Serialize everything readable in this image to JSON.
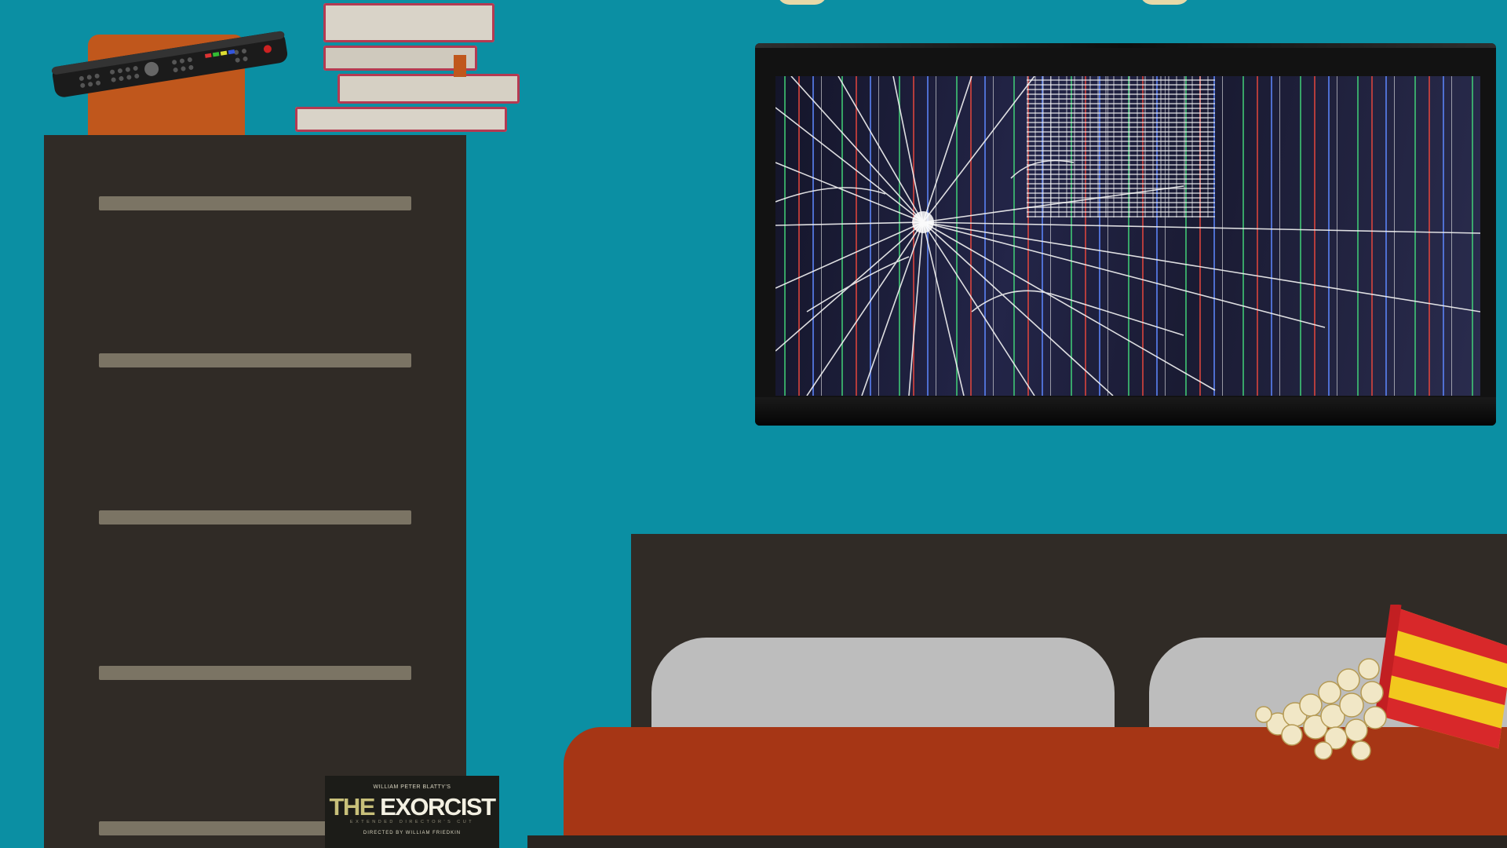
{
  "scene": {
    "colors": {
      "wall": "#0b8fa3",
      "furniture": "#302b26",
      "drawer_handle": "#7b7464",
      "blanket": "#a63615",
      "pillow": "#bdbdbd",
      "orange_block": "#c0571c",
      "popcorn_red": "#d8282a",
      "popcorn_yellow": "#f2c81e"
    },
    "tv": {
      "state": "cracked-screen",
      "brand_text": ""
    },
    "dresser": {
      "drawer_count": 5
    },
    "movie_case": {
      "credit": "WILLIAM PETER BLATTY'S",
      "title_prefix": "THE",
      "title_main": "EXORCIST",
      "edition": "EXTENDED DIRECTOR'S CUT",
      "director": "DIRECTED BY WILLIAM FRIEDKIN"
    },
    "items": {
      "remote": "tv-remote-icon",
      "popcorn": "popcorn-icon",
      "books": "book-stack-icon"
    }
  }
}
